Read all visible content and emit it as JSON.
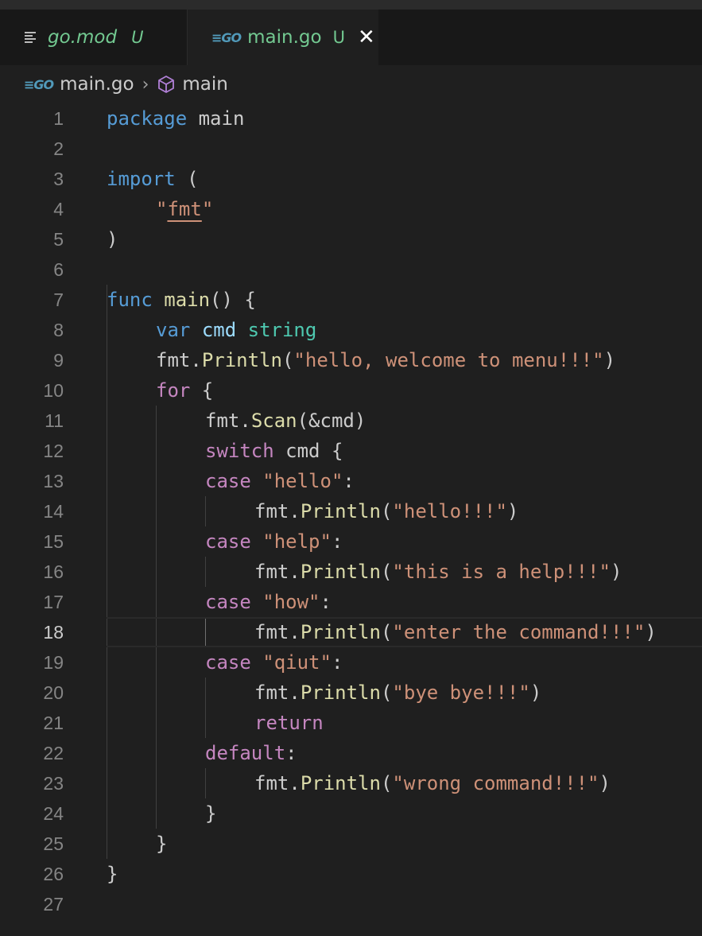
{
  "tabs": [
    {
      "filename": "go.mod",
      "status": "U",
      "icon": "lines-icon",
      "active": false
    },
    {
      "filename": "main.go",
      "status": "U",
      "icon": "go-icon",
      "active": true,
      "close": "✕"
    }
  ],
  "breadcrumb": {
    "file": "main.go",
    "separator": "›",
    "symbol": "main"
  },
  "gutter": [
    "1",
    "2",
    "3",
    "4",
    "5",
    "6",
    "7",
    "8",
    "9",
    "10",
    "11",
    "12",
    "13",
    "14",
    "15",
    "16",
    "17",
    "18",
    "19",
    "20",
    "21",
    "22",
    "23",
    "24",
    "25",
    "26",
    "27"
  ],
  "current_line": "18",
  "code": {
    "l1": [
      "package",
      " ",
      "main"
    ],
    "l3": [
      "import",
      " ("
    ],
    "l4": [
      "\"",
      "fmt",
      "\""
    ],
    "l5": [
      ")"
    ],
    "l7": [
      "func",
      " ",
      "main",
      "() {"
    ],
    "l8": [
      "var",
      " ",
      "cmd",
      " ",
      "string"
    ],
    "l9": [
      "fmt",
      ".",
      "Println",
      "(",
      "\"hello, welcome to menu!!!\"",
      ")"
    ],
    "l10": [
      "for",
      " {"
    ],
    "l11": [
      "fmt",
      ".",
      "Scan",
      "(&cmd)"
    ],
    "l12": [
      "switch",
      " cmd {"
    ],
    "l13": [
      "case",
      " ",
      "\"hello\"",
      ":"
    ],
    "l14": [
      "fmt",
      ".",
      "Println",
      "(",
      "\"hello!!!\"",
      ")"
    ],
    "l15": [
      "case",
      " ",
      "\"help\"",
      ":"
    ],
    "l16": [
      "fmt",
      ".",
      "Println",
      "(",
      "\"this is a help!!!\"",
      ")"
    ],
    "l17": [
      "case",
      " ",
      "\"how\"",
      ":"
    ],
    "l18": [
      "fmt",
      ".",
      "Println",
      "(",
      "\"enter the command!!!\"",
      ")"
    ],
    "l19": [
      "case",
      " ",
      "\"qiut\"",
      ":"
    ],
    "l20": [
      "fmt",
      ".",
      "Println",
      "(",
      "\"bye bye!!!\"",
      ")"
    ],
    "l21": [
      "return"
    ],
    "l22": [
      "default",
      ":"
    ],
    "l23": [
      "fmt",
      ".",
      "Println",
      "(",
      "\"wrong command!!!\"",
      ")"
    ],
    "l24": [
      "}"
    ],
    "l25": [
      "}"
    ],
    "l26": [
      "}"
    ]
  },
  "colors": {
    "keyword": "#569cd6",
    "control": "#c586c0",
    "function": "#dcdcaa",
    "string": "#ce9178",
    "variable": "#9cdcfe",
    "type": "#4ec9b0",
    "git_untracked": "#73c991",
    "editor_bg": "#1f1f1f"
  }
}
